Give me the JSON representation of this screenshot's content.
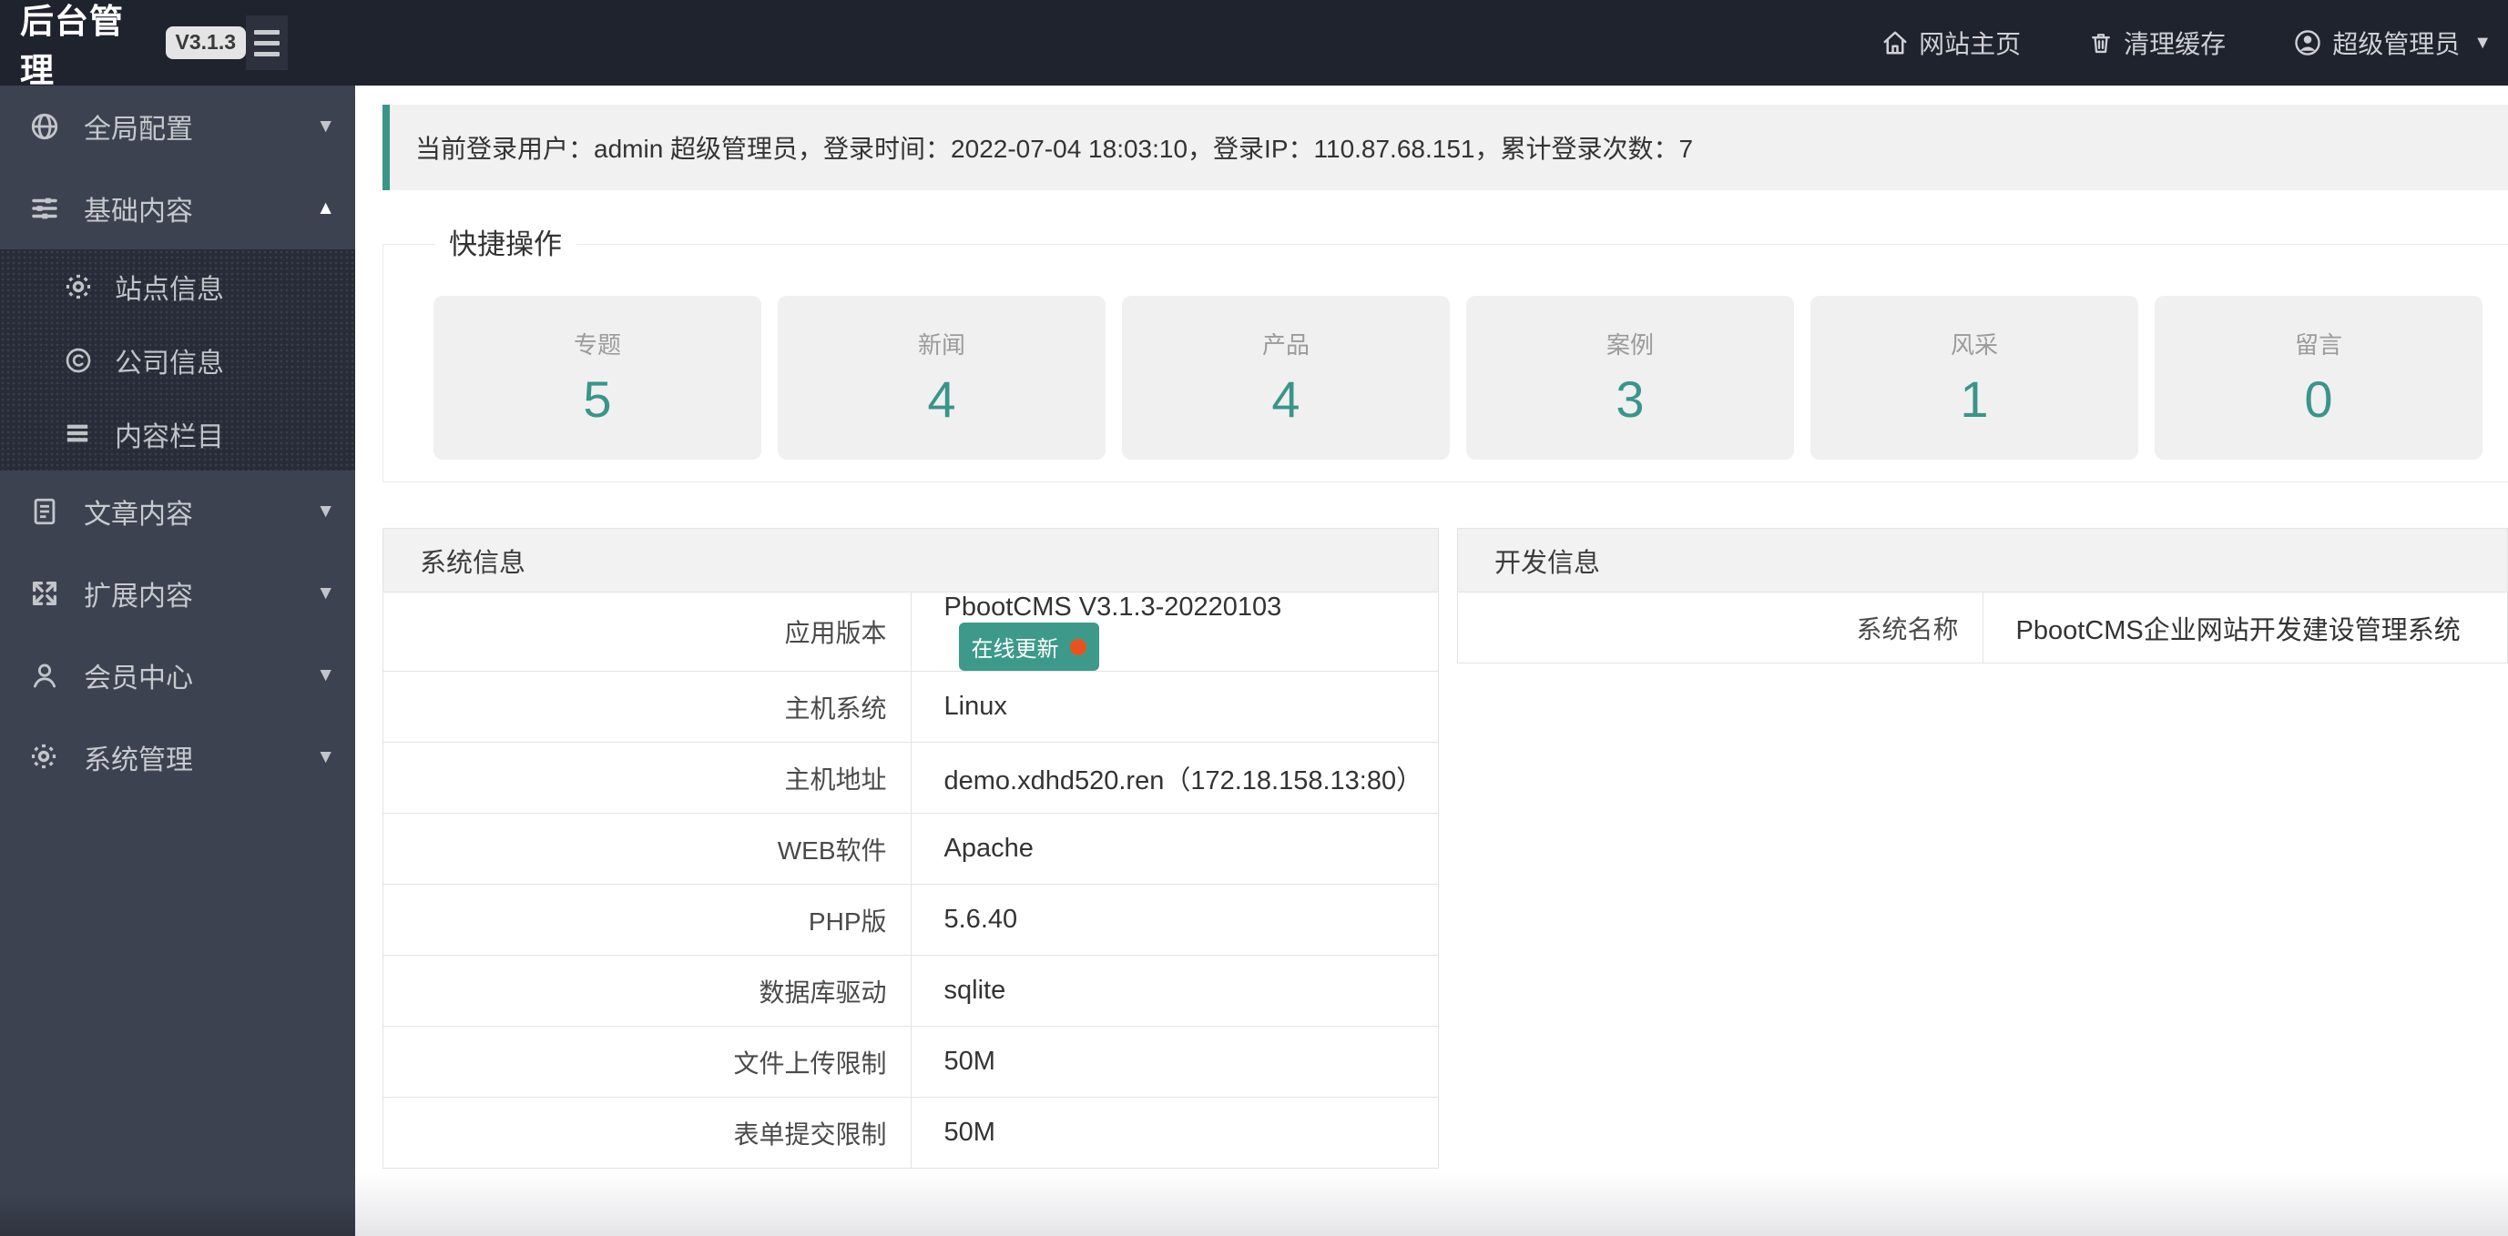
{
  "glyphs": {
    "chevron_down": "▼",
    "chevron_up": "▲"
  },
  "colors": {
    "accent": "#3a9589",
    "update_dot": "#e8531d",
    "topbar_bg": "#1f232e",
    "sidebar_bg": "#3d4250",
    "submenu_bg": "#272c38"
  },
  "topbar": {
    "title": "后台管理",
    "version": "V3.1.3",
    "links": {
      "home": "网站主页",
      "clear_cache": "清理缓存",
      "user": "超级管理员"
    }
  },
  "sidebar": {
    "items": [
      {
        "label": "全局配置",
        "icon": "globe-icon",
        "expanded": false
      },
      {
        "label": "基础内容",
        "icon": "sliders-icon",
        "expanded": true
      },
      {
        "label": "文章内容",
        "icon": "document-icon",
        "expanded": false
      },
      {
        "label": "扩展内容",
        "icon": "expand-icon",
        "expanded": false
      },
      {
        "label": "会员中心",
        "icon": "person-icon",
        "expanded": false
      },
      {
        "label": "系统管理",
        "icon": "gear-icon",
        "expanded": false
      }
    ],
    "submenu": [
      {
        "label": "站点信息",
        "icon": "gear-icon"
      },
      {
        "label": "公司信息",
        "icon": "copyright-icon"
      },
      {
        "label": "内容栏目",
        "icon": "list-icon"
      }
    ]
  },
  "login_info": {
    "text": "当前登录用户：admin 超级管理员，登录时间：2022-07-04 18:03:10，登录IP：110.87.68.151，累计登录次数：7"
  },
  "quick_actions": {
    "title": "快捷操作",
    "cards": [
      {
        "label": "专题",
        "count": "5"
      },
      {
        "label": "新闻",
        "count": "4"
      },
      {
        "label": "产品",
        "count": "4"
      },
      {
        "label": "案例",
        "count": "3"
      },
      {
        "label": "风采",
        "count": "1"
      },
      {
        "label": "留言",
        "count": "0"
      }
    ]
  },
  "system_info": {
    "title": "系统信息",
    "update_button": "在线更新",
    "rows": [
      {
        "label": "应用版本",
        "value": "PbootCMS V3.1.3-20220103"
      },
      {
        "label": "主机系统",
        "value": "Linux"
      },
      {
        "label": "主机地址",
        "value": "demo.xdhd520.ren（172.18.158.13:80）"
      },
      {
        "label": "WEB软件",
        "value": "Apache"
      },
      {
        "label": "PHP版",
        "value": "5.6.40"
      },
      {
        "label": "数据库驱动",
        "value": "sqlite"
      },
      {
        "label": "文件上传限制",
        "value": "50M"
      },
      {
        "label": "表单提交限制",
        "value": "50M"
      }
    ]
  },
  "dev_info": {
    "title": "开发信息",
    "rows": [
      {
        "label": "系统名称",
        "value": "PbootCMS企业网站开发建设管理系统"
      }
    ]
  }
}
